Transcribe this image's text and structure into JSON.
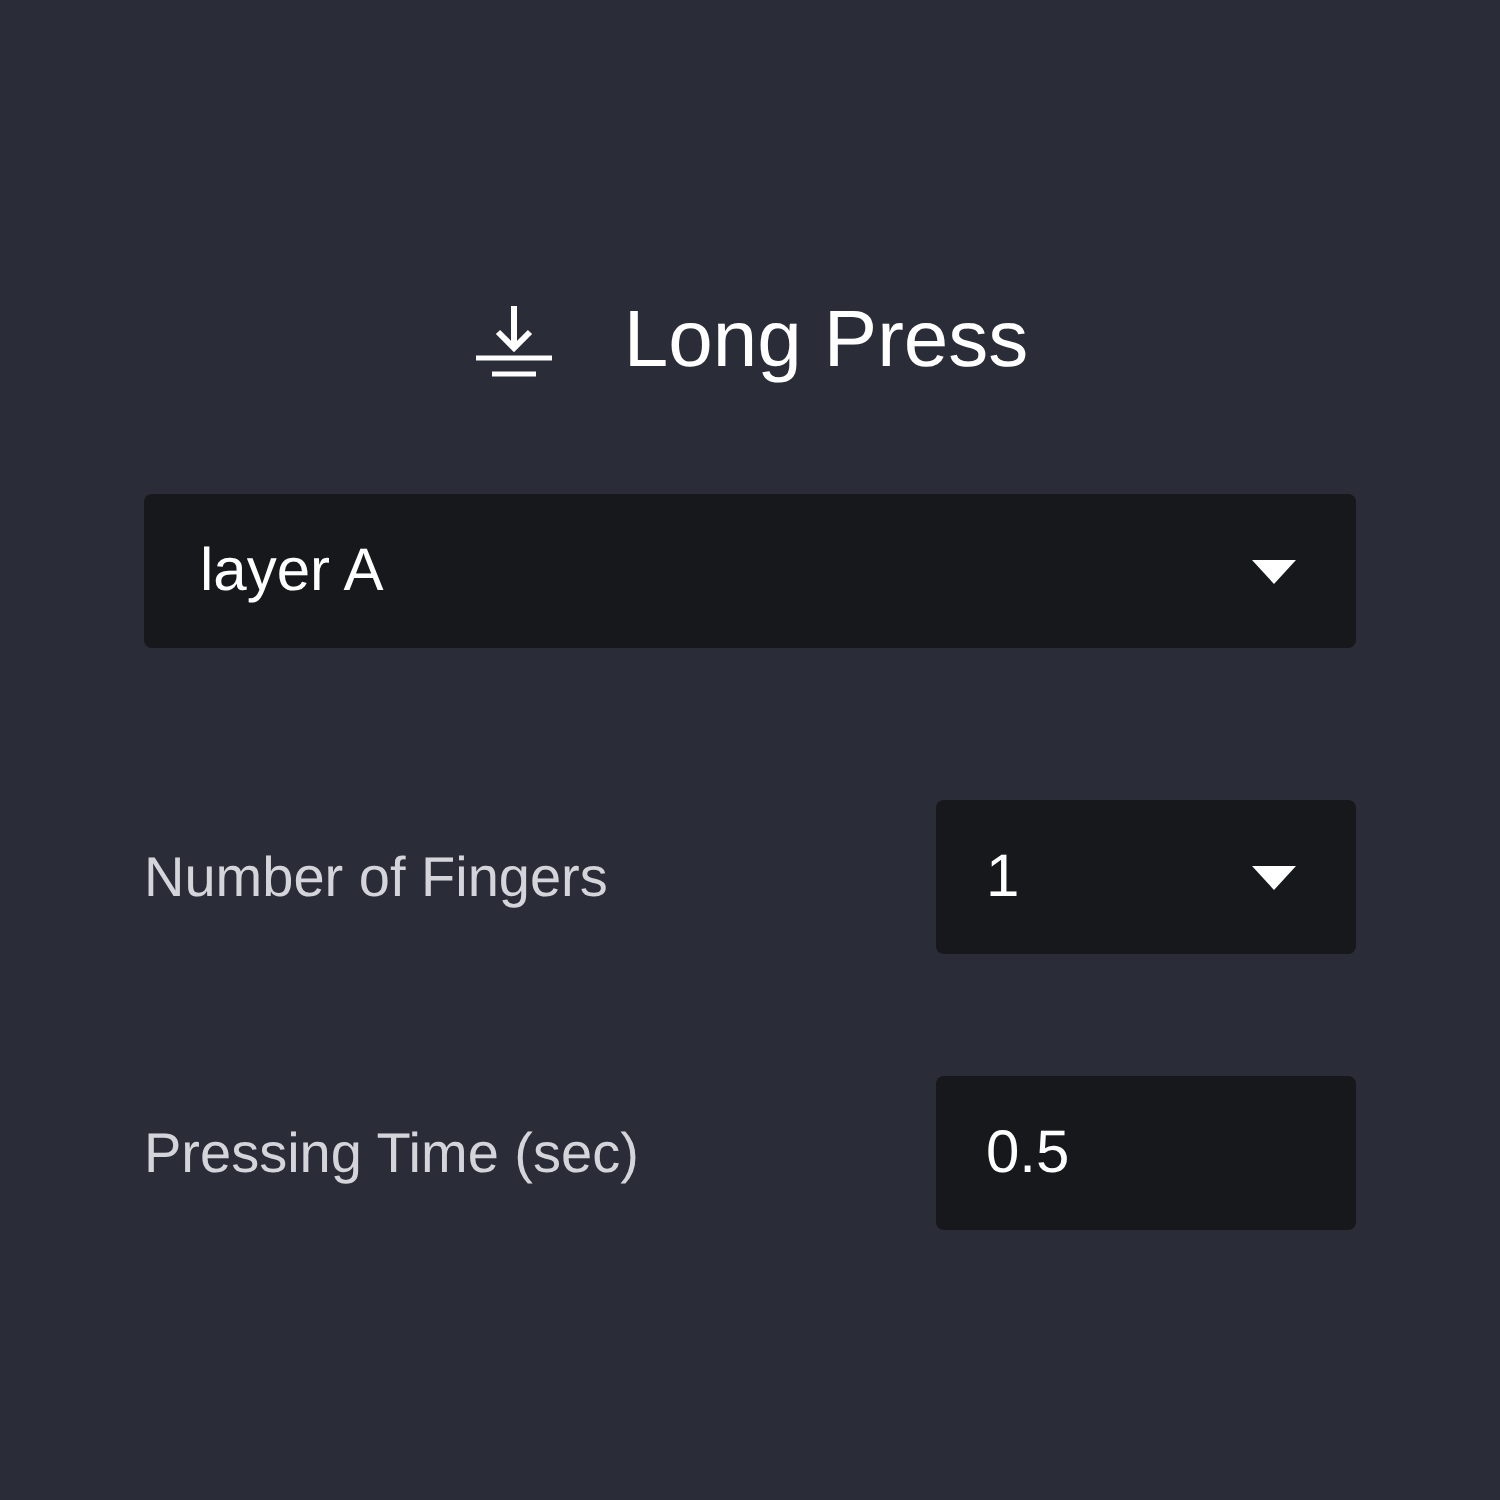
{
  "title": "Long Press",
  "layer_select": {
    "value": "layer A"
  },
  "settings": [
    {
      "kind": "dropdown",
      "label": "Number of Fingers",
      "value": "1"
    },
    {
      "kind": "input",
      "label": "Pressing Time (sec)",
      "value": "0.5"
    }
  ]
}
